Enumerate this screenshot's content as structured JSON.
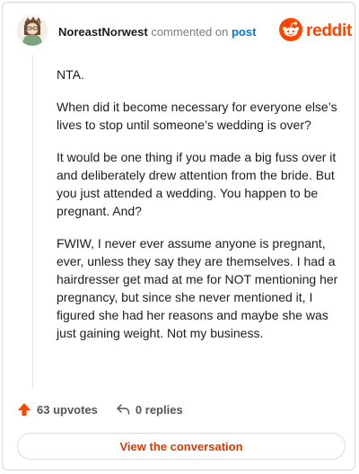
{
  "header": {
    "username": "NoreastNorwest",
    "action": "commented on",
    "post_link": "post",
    "brand": "reddit"
  },
  "comment": {
    "paragraphs": [
      "NTA.",
      "When did it become necessary for everyone else’s lives to stop until someone’s wedding is over?",
      "It would be one thing if you made a big fuss over it and deliberately drew attention from the bride. But you just attended a wedding. You happen to be pregnant. And?",
      "FWIW, I never ever assume anyone is pregnant, ever, unless they say they are themselves. I had a hairdresser get mad at me for NOT mentioning her pregnancy, but since she never mentioned it, I figured she had her reasons and maybe she was just gaining weight. Not my business."
    ]
  },
  "footer": {
    "upvotes_label": "63 upvotes",
    "replies_label": "0 replies",
    "view_button": "View the conversation"
  },
  "colors": {
    "brand_orange": "#ff4500",
    "link_blue": "#0079d3",
    "button_text": "#d93a00"
  },
  "icons": {
    "avatar": "avatar",
    "brand": "reddit-logo-icon",
    "upvote": "upvote-arrow-icon",
    "reply": "reply-arrow-icon"
  }
}
